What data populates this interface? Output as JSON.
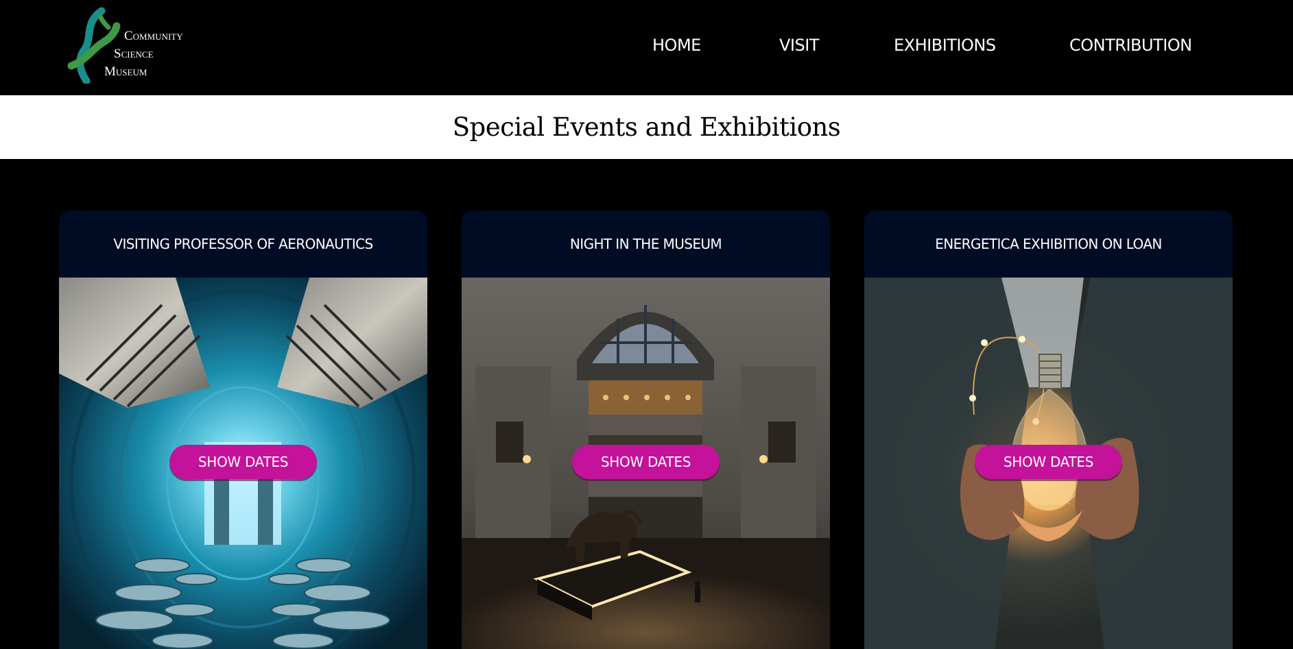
{
  "header": {
    "logo": {
      "line1": "Community",
      "line2": "Science",
      "line3": "Museum"
    },
    "nav": [
      {
        "label": "HOME"
      },
      {
        "label": "VISIT"
      },
      {
        "label": "EXHIBITIONS"
      },
      {
        "label": "CONTRIBUTION"
      }
    ]
  },
  "page": {
    "title": "Special Events and Exhibitions"
  },
  "cards": [
    {
      "title": "VISITING PROFESSOR OF AERONAUTICS",
      "image": "wind-tunnel-photo",
      "button_label": "SHOW DATES"
    },
    {
      "title": "NIGHT IN THE MUSEUM",
      "image": "museum-rotunda-elephant-photo",
      "button_label": "SHOW DATES"
    },
    {
      "title": "ENERGETICA EXHIBITION ON LOAN",
      "image": "hands-holding-lightbulb-photo",
      "button_label": "SHOW DATES"
    }
  ],
  "colors": {
    "background": "#000000",
    "card_header": "#000c24",
    "button": "#c4129a",
    "logo_green": "#3e9a46",
    "logo_teal": "#1a8e8c"
  }
}
